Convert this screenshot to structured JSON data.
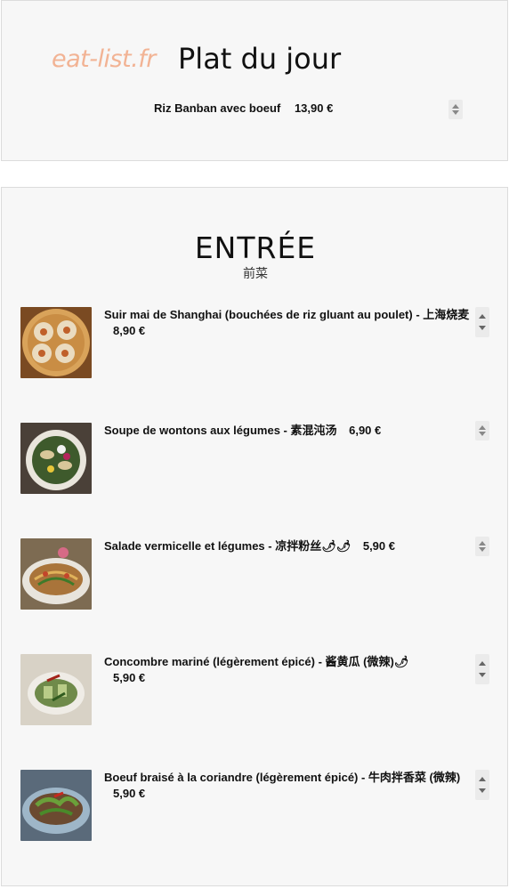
{
  "plat_du_jour": {
    "brand": "eat-list.fr",
    "title": "Plat du jour",
    "dish": "Riz Banban avec boeuf",
    "price": "13,90 €"
  },
  "entree": {
    "title": "ENTRÉE",
    "subtitle": "前菜",
    "items": [
      {
        "name": "Suir mai de Shanghai (bouchées de riz gluant au poulet) - 上海烧麦",
        "price": "8,90 €",
        "image": "shumai-steamer-photo"
      },
      {
        "name": "Soupe de wontons aux légumes - 素混沌汤",
        "price": "6,90 €",
        "image": "wonton-soup-bowl-photo"
      },
      {
        "name": "Salade vermicelle et légumes - 凉拌粉丝🌶🌶",
        "price": "5,90 €",
        "image": "vermicelli-salad-photo"
      },
      {
        "name": "Concombre mariné (légèrement épicé) - 酱黄瓜 (微辣)🌶",
        "price": "5,90 €",
        "image": "marinated-cucumber-photo"
      },
      {
        "name": "Boeuf braisé à la coriandre (légèrement épicé) - 牛肉拌香菜 (微辣)",
        "price": "5,90 €",
        "image": "braised-beef-coriander-photo"
      }
    ]
  }
}
